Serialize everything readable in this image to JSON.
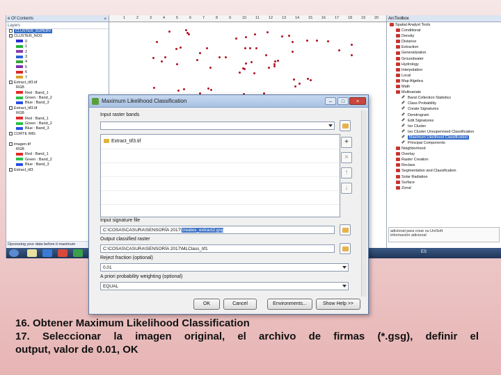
{
  "toc": {
    "title": "e Of Contents",
    "close": "×",
    "layers_label": "Layers",
    "items": [
      {
        "text": "CLUSTER_SUPERV",
        "kind": "layer-selected"
      },
      {
        "text": "CLUSTER_NOS",
        "kind": "layer"
      },
      {
        "text": "0",
        "kind": "class",
        "color": "#2b2bd6"
      },
      {
        "text": "1",
        "kind": "class",
        "color": "#27b33a"
      },
      {
        "text": "2",
        "kind": "class",
        "color": "#8b3ea8"
      },
      {
        "text": "3",
        "kind": "class",
        "color": "#2b63d6"
      },
      {
        "text": "4",
        "kind": "class",
        "color": "#38a038"
      },
      {
        "text": "5",
        "kind": "class",
        "color": "#7c2fb0"
      },
      {
        "text": "6",
        "kind": "class",
        "color": "#d62b2b"
      },
      {
        "text": "7",
        "kind": "class",
        "color": "#d6a22b"
      },
      {
        "text": "Extract_tif3.tif",
        "kind": "layer"
      },
      {
        "text": "RGB",
        "kind": "group"
      },
      {
        "text": "Red : Band_1",
        "kind": "class",
        "color": "#e52a2a"
      },
      {
        "text": "Green : Band_2",
        "kind": "class",
        "color": "#2ac14a"
      },
      {
        "text": "Blue : Band_3",
        "kind": "class",
        "color": "#2a4ee5"
      },
      {
        "text": "Extract_tif3.tif",
        "kind": "layer"
      },
      {
        "text": "RGB",
        "kind": "group"
      },
      {
        "text": "Red : Band_1",
        "kind": "class",
        "color": "#e52a2a"
      },
      {
        "text": "Green : Band_2",
        "kind": "class",
        "color": "#2ac14a"
      },
      {
        "text": "Blue : Band_3",
        "kind": "class",
        "color": "#2a4ee5"
      },
      {
        "text": "CORTE IMG",
        "kind": "layer"
      },
      {
        "text": "",
        "kind": "blank"
      },
      {
        "text": "imagen.tif",
        "kind": "layer"
      },
      {
        "text": "RGB",
        "kind": "group"
      },
      {
        "text": "Red : Band_1",
        "kind": "class",
        "color": "#e52a2a"
      },
      {
        "text": "Green : Band_2",
        "kind": "class",
        "color": "#2ac14a"
      },
      {
        "text": "Blue : Band_3",
        "kind": "class",
        "color": "#2a4ee5"
      },
      {
        "text": "Extract_tif3",
        "kind": "layer"
      }
    ],
    "status": "Opcessing your data before it maximum"
  },
  "map": {
    "ruler_ticks": [
      "1",
      "2",
      "3",
      "4",
      "5",
      "6",
      "7",
      "8",
      "9",
      "10",
      "11",
      "12",
      "13",
      "14",
      "15",
      "16",
      "17",
      "18",
      "19",
      "20"
    ]
  },
  "toolbox": {
    "title": "ArcToolbox",
    "items": [
      {
        "text": "Spatial Analyst Tools",
        "kind": "box",
        "level": 0
      },
      {
        "text": "Conditional",
        "kind": "box",
        "level": 1
      },
      {
        "text": "Density",
        "kind": "box",
        "level": 1
      },
      {
        "text": "Distance",
        "kind": "box",
        "level": 1
      },
      {
        "text": "Extraction",
        "kind": "box",
        "level": 1
      },
      {
        "text": "Generalization",
        "kind": "box",
        "level": 1
      },
      {
        "text": "Groundwater",
        "kind": "box",
        "level": 1
      },
      {
        "text": "Hydrology",
        "kind": "box",
        "level": 1
      },
      {
        "text": "Interpolation",
        "kind": "box",
        "level": 1
      },
      {
        "text": "Local",
        "kind": "box",
        "level": 1
      },
      {
        "text": "Map Algebra",
        "kind": "box",
        "level": 1
      },
      {
        "text": "Math",
        "kind": "box",
        "level": 1
      },
      {
        "text": "Multivariate",
        "kind": "box",
        "level": 1
      },
      {
        "text": "Band Collection Statistics",
        "kind": "tool",
        "level": 2
      },
      {
        "text": "Class Probability",
        "kind": "tool",
        "level": 2
      },
      {
        "text": "Create Signatures",
        "kind": "tool",
        "level": 2
      },
      {
        "text": "Dendrogram",
        "kind": "tool",
        "level": 2
      },
      {
        "text": "Edit Signatures",
        "kind": "tool",
        "level": 2
      },
      {
        "text": "Iso Cluster",
        "kind": "tool",
        "level": 2
      },
      {
        "text": "Iso Cluster Unsupervised Classification",
        "kind": "tool",
        "level": 2
      },
      {
        "text": "Maximum Likelihood Classification",
        "kind": "tool-selected",
        "level": 2
      },
      {
        "text": "Principal Components",
        "kind": "tool",
        "level": 2
      },
      {
        "text": "Neighborhood",
        "kind": "box",
        "level": 1
      },
      {
        "text": "Overlay",
        "kind": "box",
        "level": 1
      },
      {
        "text": "Raster Creation",
        "kind": "box",
        "level": 1
      },
      {
        "text": "Reclass",
        "kind": "box",
        "level": 1
      },
      {
        "text": "Segmentation and Classification",
        "kind": "box",
        "level": 1
      },
      {
        "text": "Solar Radiation",
        "kind": "box",
        "level": 1
      },
      {
        "text": "Surface",
        "kind": "box",
        "level": 1
      },
      {
        "text": "Zonal",
        "kind": "box",
        "level": 1
      }
    ],
    "hint_line1": "adicional para crear su UniSoft",
    "hint_line2": "información adicional"
  },
  "taskbar": {
    "lang": "ES"
  },
  "dialog": {
    "title": "Maximum Likelihood Classification",
    "minimize": "–",
    "maximize": "□",
    "close": "×",
    "input_raster_label": "Input raster bands",
    "input_raster_value": "",
    "list_items": [
      "Extract_tif3.tif"
    ],
    "signature_label": "Input signature file",
    "signature_prefix": "C:\\COSAS\\CASURA\\SENSORÍA 2017\\",
    "signature_selected": "creates_extract2.gsg",
    "output_label": "Output classified raster",
    "output_value": "C:\\COSAS\\CASURA\\SENSORÍA 2017\\MLClass_tif1",
    "reject_label": "Reject fraction (optional)",
    "reject_value": "0.01",
    "apriori_label": "A priori probability weighting (optional)",
    "apriori_value": "EQUAL",
    "btn_ok": "OK",
    "btn_cancel": "Cancel",
    "btn_env": "Environments...",
    "btn_help": "Show Help >>",
    "side_add": "+",
    "side_remove": "×",
    "side_up": "↑",
    "side_down": "↓"
  },
  "caption": {
    "line1": "16. Obtener Maximum Likelihood Classification",
    "line2": "17. Seleccionar la imagen original, el archivo de firmas (*.gsg), definir el",
    "line3": "output, valor de 0.01, OK"
  }
}
